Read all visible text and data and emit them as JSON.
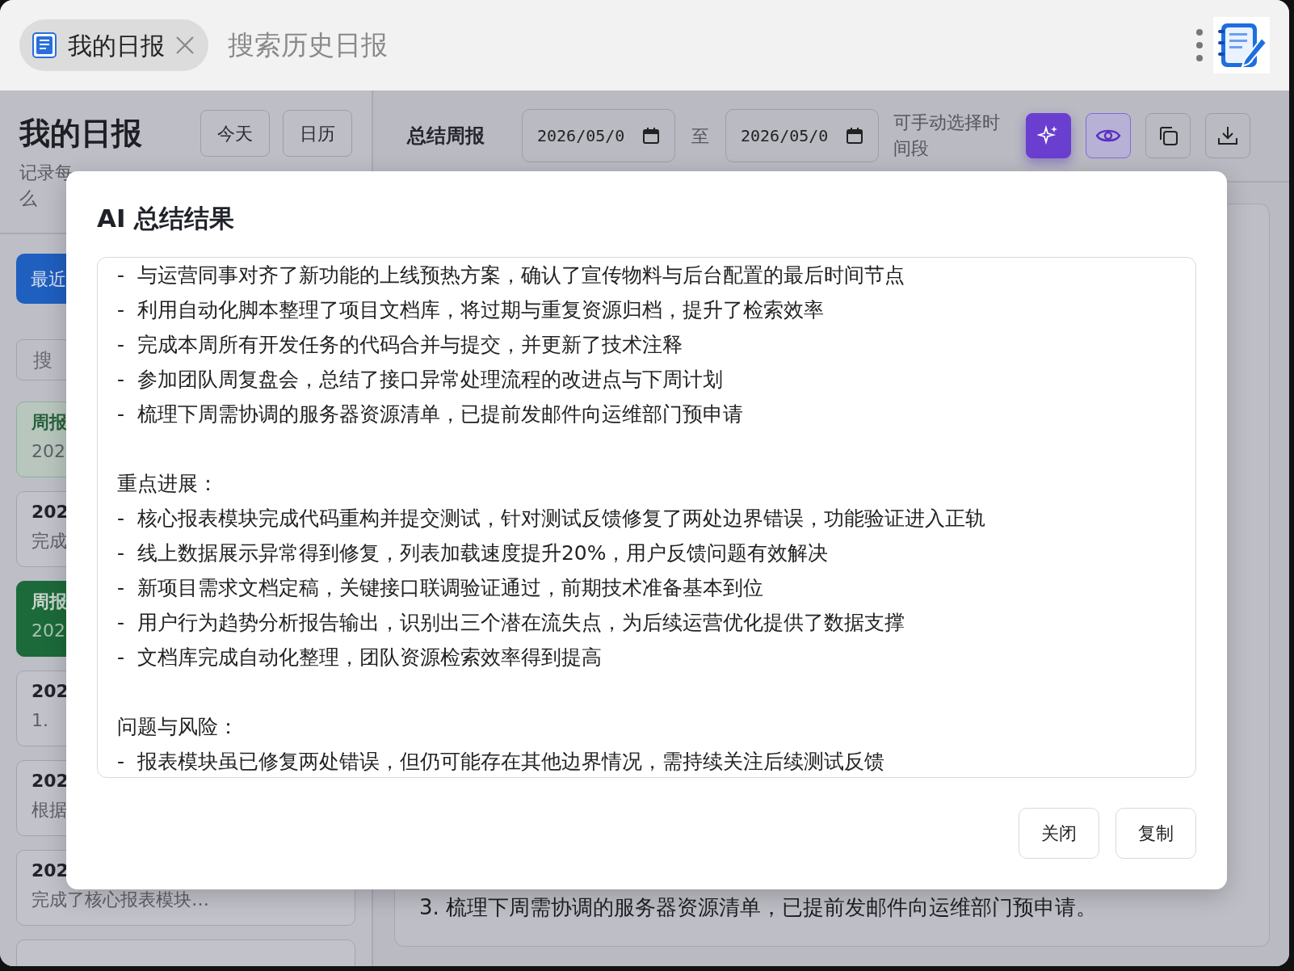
{
  "tab_bar": {
    "tab": {
      "title": "我的日报",
      "selected": true
    },
    "search": {
      "placeholder": "搜索历史日报"
    }
  },
  "sidebar": {
    "title": "我的日报",
    "buttons": [
      "今天",
      "日历"
    ],
    "subtitle_lines": [
      "记录每",
      "么"
    ],
    "filter_button": {
      "label": "最近",
      "selected": true
    },
    "search": {
      "placeholder": "搜"
    },
    "entries": [
      {
        "kind": "weekly",
        "title": "周报",
        "subtitle": "202",
        "selected": false
      },
      {
        "kind": "daily",
        "title": "202",
        "subtitle": "完成",
        "selected": false
      },
      {
        "kind": "weekly",
        "title": "周报",
        "subtitle": "202",
        "selected": true
      },
      {
        "kind": "daily",
        "title": "202",
        "subtitle": "1.",
        "selected": false
      },
      {
        "kind": "daily",
        "title": "202",
        "subtitle": "根据",
        "selected": false
      },
      {
        "kind": "daily",
        "title": "202",
        "subtitle": "完成了核心报表模块…",
        "selected": false
      },
      {
        "kind": "daily",
        "selected": false
      }
    ]
  },
  "main": {
    "title": "总结周报",
    "start_date": "2026/05/0",
    "separator": "至",
    "end_date": "2026/05/0",
    "hint": "可手动选择时间段",
    "content_lines": [
      "3. 梳理下周需协调的服务器资源清单，已提前发邮件向运维部门预申请。"
    ]
  },
  "modal": {
    "title": "AI 总结结果",
    "lines": [
      {
        "kind": "item",
        "text": "-  与运营同事对齐了新功能的上线预热方案，确认了宣传物料与后台配置的最后时间节点"
      },
      {
        "kind": "item",
        "text": "-  利用自动化脚本整理了项目文档库，将过期与重复资源归档，提升了检索效率"
      },
      {
        "kind": "item",
        "text": "-  完成本周所有开发任务的代码合并与提交，并更新了技术注释"
      },
      {
        "kind": "item",
        "text": "-  参加团队周复盘会，总结了接口异常处理流程的改进点与下周计划"
      },
      {
        "kind": "item",
        "text": "-  梳理下周需协调的服务器资源清单，已提前发邮件向运维部门预申请"
      },
      {
        "kind": "blank"
      },
      {
        "kind": "heading",
        "text": "重点进展："
      },
      {
        "kind": "item",
        "text": "-  核心报表模块完成代码重构并提交测试，针对测试反馈修复了两处边界错误，功能验证进入正轨"
      },
      {
        "kind": "item",
        "text": "-  线上数据展示异常得到修复，列表加载速度提升20%，用户反馈问题有效解决"
      },
      {
        "kind": "item",
        "text": "-  新项目需求文档定稿，关键接口联调验证通过，前期技术准备基本到位"
      },
      {
        "kind": "item",
        "text": "-  用户行为趋势分析报告输出，识别出三个潜在流失点，为后续运营优化提供了数据支撑"
      },
      {
        "kind": "item",
        "text": "-  文档库完成自动化整理，团队资源检索效率得到提高"
      },
      {
        "kind": "blank"
      },
      {
        "kind": "heading",
        "text": "问题与风险："
      },
      {
        "kind": "item",
        "text": "-  报表模块虽已修复两处错误，但仍可能存在其他边界情况，需持续关注后续测试反馈"
      }
    ],
    "buttons": [
      "关闭",
      "复制"
    ]
  }
}
